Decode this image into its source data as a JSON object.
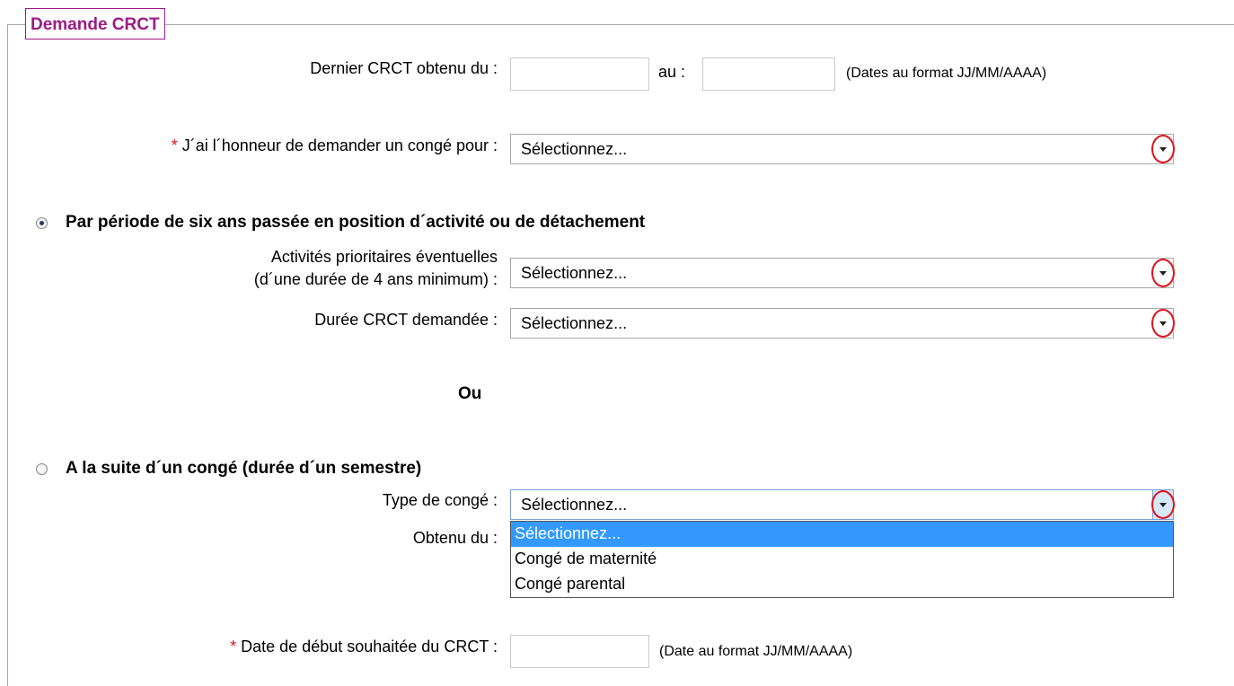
{
  "legend": "Demande CRCT",
  "last_crct": {
    "label": "Dernier CRCT obtenu du :",
    "from_value": "",
    "to_label": "au :",
    "to_value": "",
    "hint": "(Dates au format JJ/MM/AAAA)"
  },
  "request": {
    "required_mark": "*",
    "label": "J´ai l´honneur de demander un congé pour :",
    "selected": "Sélectionnez..."
  },
  "option_six_years": {
    "checked": true,
    "label": "Par période de six ans passée en position d´activité ou de détachement",
    "priority_label_line1": "Activités prioritaires éventuelles",
    "priority_label_line2": "(d´une durée de 4 ans minimum) :",
    "priority_selected": "Sélectionnez...",
    "duration_label": "Durée CRCT demandée :",
    "duration_selected": "Sélectionnez..."
  },
  "separator": "Ou",
  "option_after_leave": {
    "checked": false,
    "label": "A la suite d´un congé (durée d´un semestre)",
    "type_label": "Type de congé :",
    "type_selected": "Sélectionnez...",
    "type_options": [
      "Sélectionnez...",
      "Congé de maternité",
      "Congé parental"
    ],
    "obtained_label": "Obtenu du :"
  },
  "start_date": {
    "required_mark": "*",
    "label": "Date de début souhaitée du CRCT :",
    "value": "",
    "hint": "(Date au format JJ/MM/AAAA)"
  },
  "colors": {
    "legend": "#9c1b84",
    "required": "#e0111b",
    "annotation_ring": "#e0111b",
    "dropdown_highlight": "#3399ff"
  },
  "icons": [
    "dropdown-arrow-icon",
    "radio-icon"
  ]
}
